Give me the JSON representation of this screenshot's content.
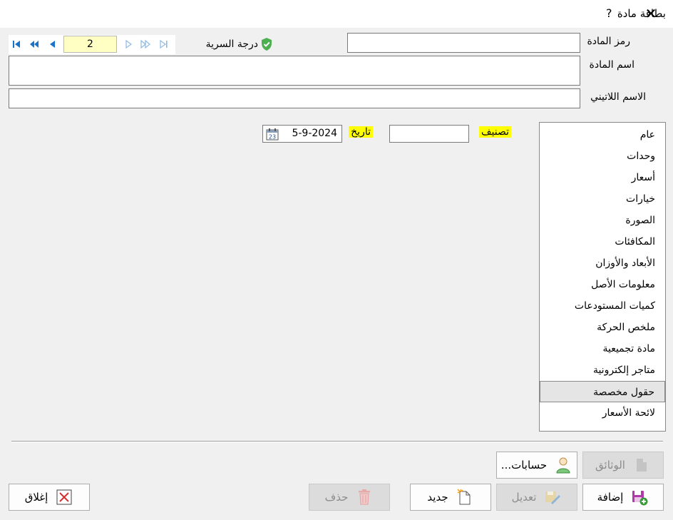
{
  "window": {
    "title": "بطاقة مادة",
    "help_label": "?",
    "close_label": "✕"
  },
  "nav": {
    "current_page": "2"
  },
  "security": {
    "label": "درجة السرية"
  },
  "form": {
    "code_label": "رمز المادة",
    "name_label": "اسم المادة",
    "latin_label": "الاسم اللاتيني",
    "classification_label": "تصنيف",
    "date_label": "تاريخ",
    "date_value": "5-9-2024",
    "code_value": "",
    "classification_value": ""
  },
  "tabs": [
    "عام",
    "وحدات",
    "أسعار",
    "خيارات",
    "الصورة",
    "المكافئات",
    "الأبعاد والأوزان",
    "معلومات الأصل",
    "كميات المستودعات",
    "ملخص الحركة",
    "مادة تجميعية",
    "متاجر إلكترونية",
    "حقول مخصصة",
    "لائحة الأسعار"
  ],
  "selected_tab_index": 12,
  "buttons": {
    "documents": "الوثائق",
    "accounts": "حسابات...",
    "add": "إضافة",
    "edit": "تعديل",
    "new": "جديد",
    "delete": "حذف",
    "close": "إغلاق"
  },
  "colors": {
    "highlight": "#ffff00",
    "page_field": "#ffffc4",
    "nav_icon": "#1a73c9"
  }
}
